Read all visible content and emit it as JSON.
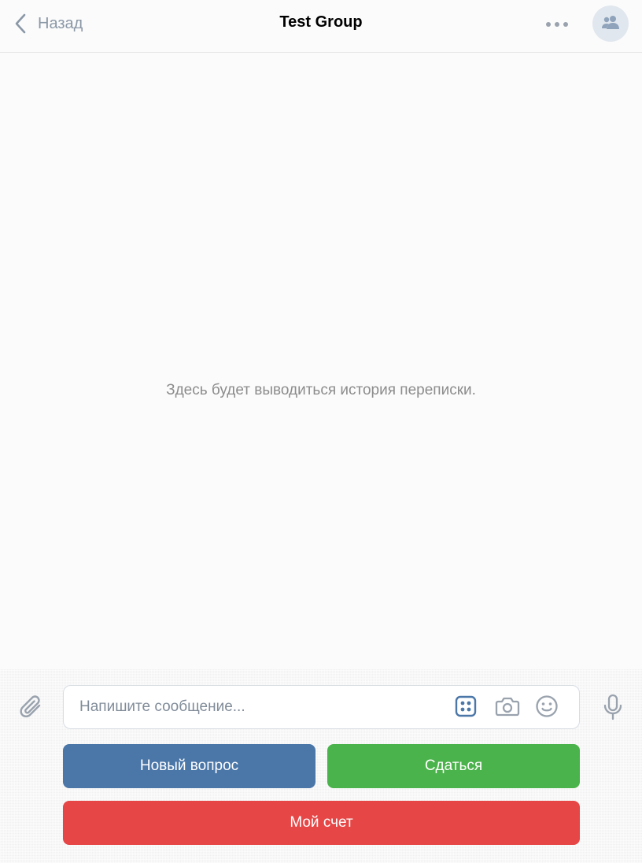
{
  "header": {
    "back_label": "Назад",
    "title": "Test Group"
  },
  "chat": {
    "empty_text": "Здесь будет выводиться история переписки."
  },
  "composer": {
    "placeholder": "Напишите сообщение..."
  },
  "keyboard": {
    "new_question": "Новый вопрос",
    "give_up": "Сдаться",
    "my_score": "Мой счет"
  },
  "colors": {
    "accent_blue": "#4a76a8",
    "green": "#4bb34b",
    "red": "#e64646",
    "icon_gray": "#99a2ad"
  },
  "icons": [
    "chevron-left-icon",
    "more-icon",
    "group-avatar-icon",
    "paperclip-icon",
    "bot-keyboard-icon",
    "camera-icon",
    "smile-icon",
    "microphone-icon"
  ]
}
